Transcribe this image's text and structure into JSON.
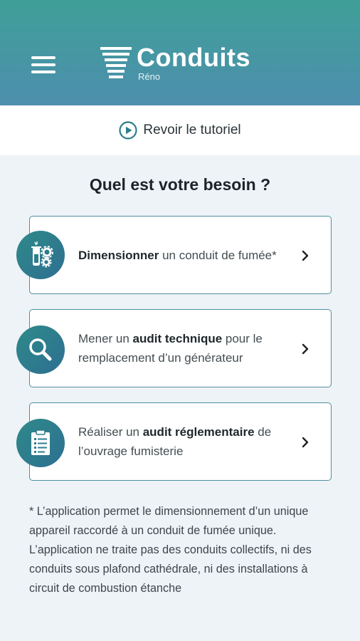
{
  "header": {
    "logo_title": "Conduits",
    "logo_subtitle": "Réno",
    "menu_icon": "hamburger-icon"
  },
  "tutorial": {
    "label": "Revoir le tutoriel",
    "icon": "play-circle-icon"
  },
  "question": "Quel est votre besoin ?",
  "options": [
    {
      "icon": "gears-flask-icon",
      "pre": "",
      "bold": "Dimensionner",
      "post": " un conduit de fumée*"
    },
    {
      "icon": "magnifier-icon",
      "pre": "Mener un ",
      "bold": "audit technique",
      "post": " pour le remplacement d’un générateur"
    },
    {
      "icon": "clipboard-checklist-icon",
      "pre": "Réaliser un ",
      "bold": "audit réglementaire",
      "post": " de l’ouvrage fumisterie"
    }
  ],
  "footnote": "* L’application permet le dimensionnement d’un unique appareil raccordé à un conduit de fumée unique. L’application ne traite pas des conduits collectifs, ni des conduits sous plafond cathédrale, ni des installations à circuit de combustion étanche",
  "colors": {
    "header_top": "#3f9f97",
    "header_bottom": "#4d8fae",
    "accent": "#2e7d8e",
    "background": "#eef3f7"
  }
}
